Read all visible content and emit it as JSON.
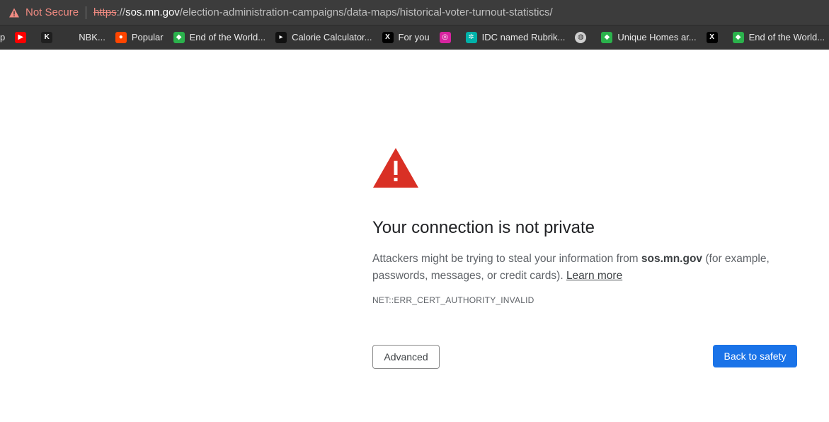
{
  "address_bar": {
    "security_label": "Not Secure",
    "url_scheme": "https",
    "url_sep": "://",
    "url_host": "sos.mn.gov",
    "url_path": "/election-administration-campaigns/data-maps/historical-voter-turnout-statistics/"
  },
  "bookmarks": [
    {
      "label": "p",
      "icon": "truncated-icon",
      "color": ""
    },
    {
      "label": "",
      "icon": "youtube-icon",
      "color": "#ff0000"
    },
    {
      "label": "",
      "icon": "k-logo-icon",
      "color": "#1f1f1f"
    },
    {
      "label": "NBK...",
      "icon": "",
      "color": ""
    },
    {
      "label": "Popular",
      "icon": "reddit-icon",
      "color": "#ff4500"
    },
    {
      "label": "End of the World...",
      "icon": "feedly-icon",
      "color": "#2bb24c"
    },
    {
      "label": "Calorie Calculator...",
      "icon": "play-icon",
      "color": "#111111"
    },
    {
      "label": "For you",
      "icon": "x-icon",
      "color": "#000000"
    },
    {
      "label": "",
      "icon": "instagram-icon",
      "color": "#d6249f"
    },
    {
      "label": "IDC named Rubrik...",
      "icon": "rubrik-icon",
      "color": "#00b2a9"
    },
    {
      "label": "",
      "icon": "globe-icon",
      "color": "#cfcfcf"
    },
    {
      "label": "Unique Homes ar...",
      "icon": "feedly-icon",
      "color": "#2bb24c"
    },
    {
      "label": "",
      "icon": "x-icon",
      "color": "#000000"
    },
    {
      "label": "End of the World...",
      "icon": "feedly-icon",
      "color": "#2bb24c"
    },
    {
      "label": "",
      "icon": "feedly-icon",
      "color": "#2bb24c"
    }
  ],
  "interstitial": {
    "title": "Your connection is not private",
    "desc_pre": "Attackers might be trying to steal your information from ",
    "desc_host": "sos.mn.gov",
    "desc_post": " (for example, passwords, messages, or credit cards). ",
    "learn_more": "Learn more",
    "error_code": "NET::ERR_CERT_AUTHORITY_INVALID",
    "advanced_label": "Advanced",
    "back_label": "Back to safety"
  },
  "colors": {
    "warning_red": "#d93025",
    "primary_blue": "#1a73e8",
    "not_secure": "#f28b82"
  }
}
